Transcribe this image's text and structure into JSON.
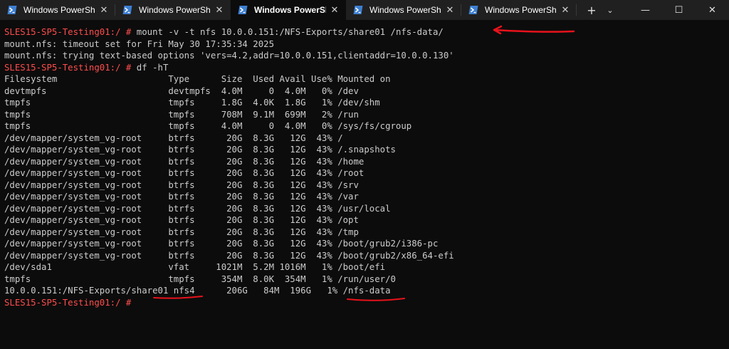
{
  "tabs": [
    {
      "title": "Windows PowerShel",
      "active": false
    },
    {
      "title": "Windows PowerShel",
      "active": false
    },
    {
      "title": "Windows PowerShe",
      "active": true
    },
    {
      "title": "Windows PowerShel",
      "active": false
    },
    {
      "title": "Windows PowerShel",
      "active": false
    }
  ],
  "titlebar": {
    "close_tab_glyph": "✕",
    "new_tab_glyph": "+",
    "dropdown_glyph": "⌄",
    "minimize_glyph": "—",
    "maximize_glyph": "☐",
    "close_window_glyph": "✕",
    "icons": {
      "tab": "powershell-icon",
      "new_tab": "plus-icon",
      "dropdown": "chevron-down-icon",
      "minimize": "minimize-icon",
      "maximize": "maximize-icon",
      "close": "close-icon"
    }
  },
  "terminal": {
    "prompt": "SLES15-SP5-Testing01:/ #",
    "commands": {
      "mount": " mount -v -t nfs 10.0.0.151:/NFS-Exports/share01 /nfs-data/",
      "df": " df -hT",
      "empty": " "
    },
    "mount_output": [
      "mount.nfs: timeout set for Fri May 30 17:35:34 2025",
      "mount.nfs: trying text-based options 'vers=4.2,addr=10.0.0.151,clientaddr=10.0.0.130'"
    ],
    "df_header": "Filesystem                     Type      Size  Used Avail Use% Mounted on",
    "df_rows": [
      "devtmpfs                       devtmpfs  4.0M     0  4.0M   0% /dev",
      "tmpfs                          tmpfs     1.8G  4.0K  1.8G   1% /dev/shm",
      "tmpfs                          tmpfs     708M  9.1M  699M   2% /run",
      "tmpfs                          tmpfs     4.0M     0  4.0M   0% /sys/fs/cgroup",
      "/dev/mapper/system_vg-root     btrfs      20G  8.3G   12G  43% /",
      "/dev/mapper/system_vg-root     btrfs      20G  8.3G   12G  43% /.snapshots",
      "/dev/mapper/system_vg-root     btrfs      20G  8.3G   12G  43% /home",
      "/dev/mapper/system_vg-root     btrfs      20G  8.3G   12G  43% /root",
      "/dev/mapper/system_vg-root     btrfs      20G  8.3G   12G  43% /srv",
      "/dev/mapper/system_vg-root     btrfs      20G  8.3G   12G  43% /var",
      "/dev/mapper/system_vg-root     btrfs      20G  8.3G   12G  43% /usr/local",
      "/dev/mapper/system_vg-root     btrfs      20G  8.3G   12G  43% /opt",
      "/dev/mapper/system_vg-root     btrfs      20G  8.3G   12G  43% /tmp",
      "/dev/mapper/system_vg-root     btrfs      20G  8.3G   12G  43% /boot/grub2/i386-pc",
      "/dev/mapper/system_vg-root     btrfs      20G  8.3G   12G  43% /boot/grub2/x86_64-efi",
      "/dev/sda1                      vfat     1021M  5.2M 1016M   1% /boot/efi",
      "tmpfs                          tmpfs     354M  8.0K  354M   1% /run/user/0",
      "10.0.0.151:/NFS-Exports/share01 nfs4      206G   84M  196G   1% /nfs-data"
    ]
  },
  "colors": {
    "prompt": "#ff4d4d",
    "text": "#cccccc",
    "background": "#0c0c0c",
    "titlebar": "#202020",
    "annotation": "#e8121b"
  }
}
